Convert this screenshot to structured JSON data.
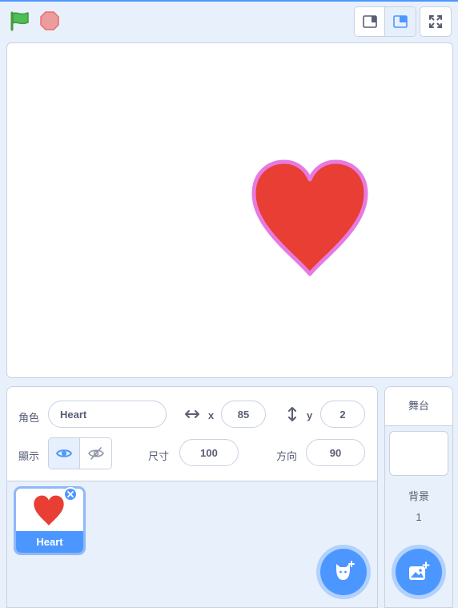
{
  "toolbar": {
    "green_flag_icon": "green-flag-icon",
    "stop_icon": "stop-icon",
    "small_stage_icon": "small-stage-icon",
    "large_stage_icon": "large-stage-icon",
    "fullscreen_icon": "fullscreen-icon"
  },
  "stage": {
    "sprite_icon": "heart-icon",
    "sprite_fill": "#e83e33",
    "sprite_outline": "#e67ae0"
  },
  "sprite_info": {
    "sprite_label": "角色",
    "sprite_name": "Heart",
    "x_label": "x",
    "x_value": "85",
    "y_label": "y",
    "y_value": "2",
    "show_label": "顯示",
    "size_label": "尺寸",
    "size_value": "100",
    "direction_label": "方向",
    "direction_value": "90"
  },
  "sprite_list": [
    {
      "name": "Heart",
      "selected": true
    }
  ],
  "stage_panel": {
    "title": "舞台",
    "backdrop_label": "背景",
    "backdrop_count": "1"
  },
  "colors": {
    "accent": "#4c97ff",
    "panel_bg": "#e8f0fb",
    "text": "#575e75"
  }
}
